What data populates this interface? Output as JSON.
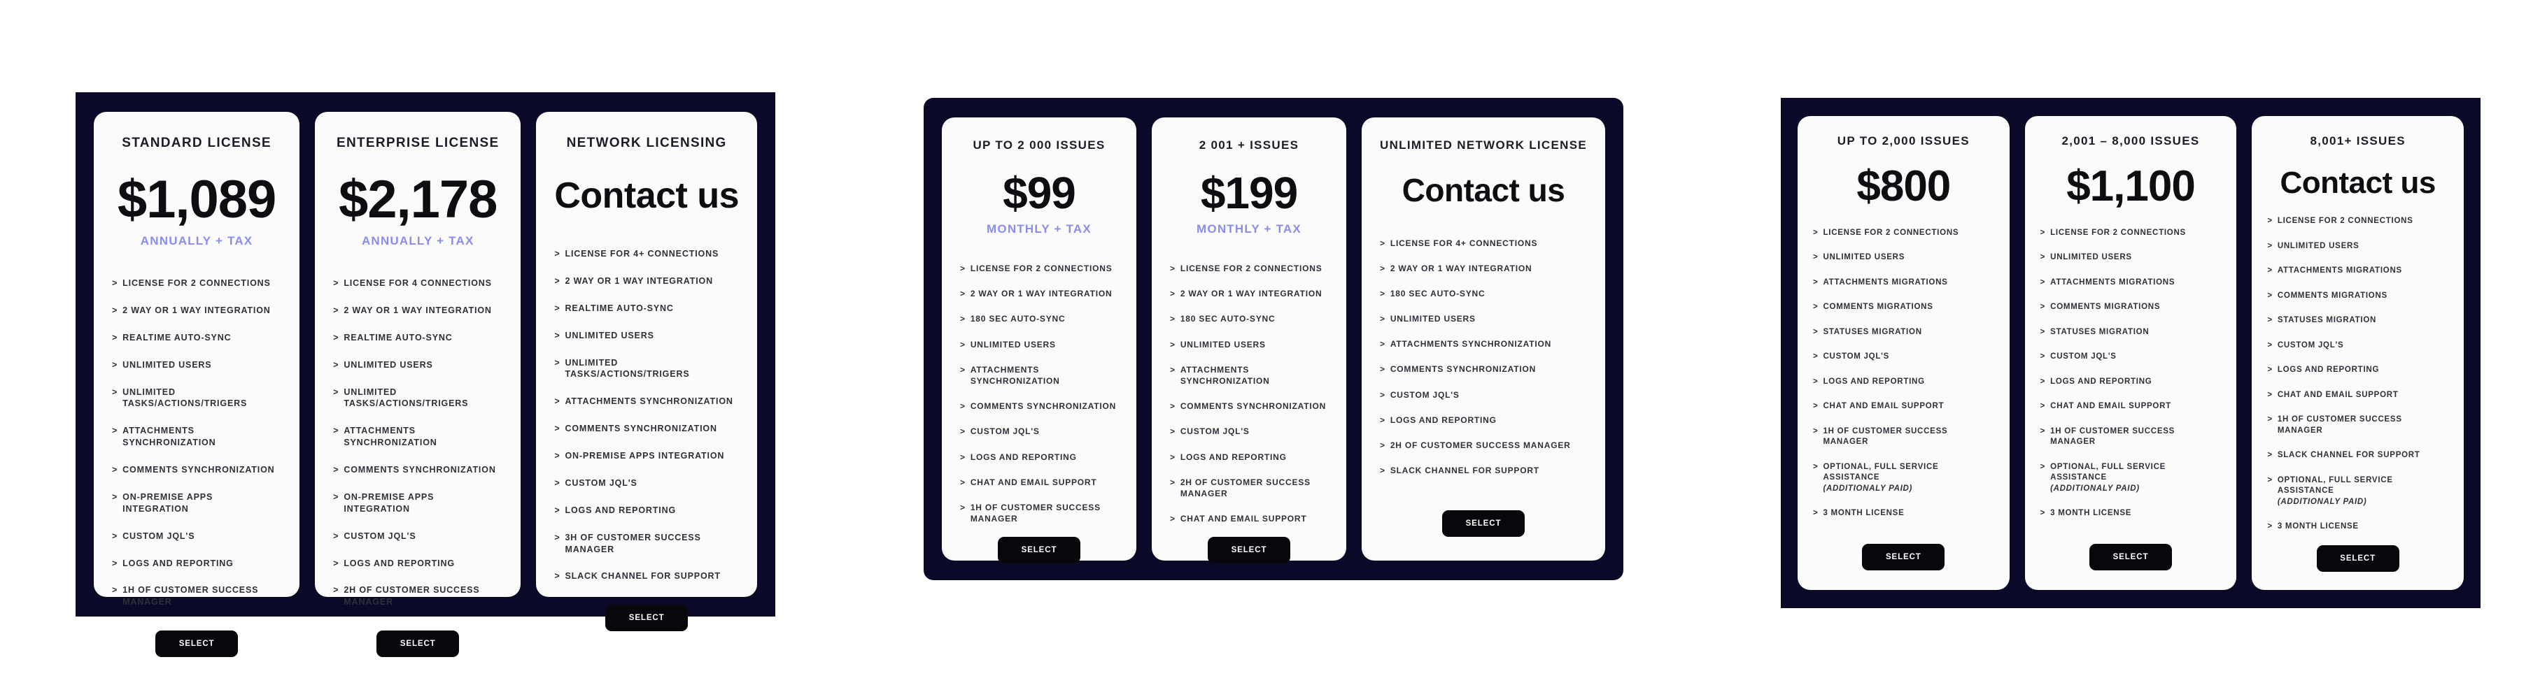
{
  "colors": {
    "panel_background": "#0a0a28",
    "card_background": "#fbfbfb",
    "price_text": "#0d0d12",
    "period_accent": "#8b8cf0",
    "feature_text": "#2f2f3a",
    "button_background": "#07070c",
    "button_text": "#ffffff",
    "page_background": "#ffffff"
  },
  "common": {
    "select_label": "SELECT",
    "bullet_glyph": ">"
  },
  "panels": [
    {
      "id": "panel-connection-licenses",
      "cards": [
        {
          "title": "STANDARD LICENSE",
          "price": "$1,089",
          "is_contact": false,
          "period": "ANNUALLY + TAX",
          "features": [
            "LICENSE FOR 2 CONNECTIONS",
            "2 WAY OR 1 WAY INTEGRATION",
            "REALTIME AUTO-SYNC",
            "UNLIMITED USERS",
            "UNLIMITED TASKS/ACTIONS/TRIGERS",
            "ATTACHMENTS SYNCHRONIZATION",
            "COMMENTS SYNCHRONIZATION",
            "ON-PREMISE APPS INTEGRATION",
            "CUSTOM JQL'S",
            "LOGS AND REPORTING",
            "1H OF CUSTOMER SUCCESS MANAGER"
          ],
          "button": "SELECT"
        },
        {
          "title": "ENTERPRISE LICENSE",
          "price": "$2,178",
          "is_contact": false,
          "period": "ANNUALLY + TAX",
          "features": [
            "LICENSE FOR 4 CONNECTIONS",
            "2 WAY OR 1 WAY INTEGRATION",
            "REALTIME AUTO-SYNC",
            "UNLIMITED USERS",
            "UNLIMITED TASKS/ACTIONS/TRIGERS",
            "ATTACHMENTS SYNCHRONIZATION",
            "COMMENTS SYNCHRONIZATION",
            "ON-PREMISE APPS INTEGRATION",
            "CUSTOM JQL'S",
            "LOGS AND REPORTING",
            "2H OF CUSTOMER SUCCESS MANAGER"
          ],
          "button": "SELECT"
        },
        {
          "title": "NETWORK LICENSING",
          "price": "Contact us",
          "is_contact": true,
          "period": "",
          "features": [
            "LICENSE FOR 4+ CONNECTIONS",
            "2 WAY OR 1 WAY INTEGRATION",
            "REALTIME AUTO-SYNC",
            "UNLIMITED USERS",
            "UNLIMITED TASKS/ACTIONS/TRIGERS",
            "ATTACHMENTS SYNCHRONIZATION",
            "COMMENTS SYNCHRONIZATION",
            "ON-PREMISE APPS INTEGRATION",
            "CUSTOM JQL'S",
            "LOGS AND REPORTING",
            "3H OF CUSTOMER SUCCESS MANAGER",
            "SLACK CHANNEL FOR SUPPORT"
          ],
          "button": "SELECT"
        }
      ]
    },
    {
      "id": "panel-issue-tier-monthly",
      "cards": [
        {
          "title": "UP TO 2 000 ISSUES",
          "price": "$99",
          "is_contact": false,
          "period": "MONTHLY + TAX",
          "features": [
            "LICENSE FOR 2 CONNECTIONS",
            "2 WAY OR 1 WAY INTEGRATION",
            "180 SEC AUTO-SYNC",
            "UNLIMITED USERS",
            "ATTACHMENTS SYNCHRONIZATION",
            "COMMENTS SYNCHRONIZATION",
            "CUSTOM JQL'S",
            "LOGS AND REPORTING",
            "CHAT AND EMAIL SUPPORT",
            "1H OF CUSTOMER SUCCESS MANAGER"
          ],
          "button": "SELECT"
        },
        {
          "title": "2 001 + ISSUES",
          "price": "$199",
          "is_contact": false,
          "period": "MONTHLY + TAX",
          "features": [
            "LICENSE FOR 2 CONNECTIONS",
            "2 WAY OR 1 WAY INTEGRATION",
            "180 SEC AUTO-SYNC",
            "UNLIMITED USERS",
            "ATTACHMENTS SYNCHRONIZATION",
            "COMMENTS SYNCHRONIZATION",
            "CUSTOM JQL'S",
            "LOGS AND REPORTING",
            "2H OF CUSTOMER SUCCESS MANAGER",
            "CHAT AND EMAIL SUPPORT"
          ],
          "button": "SELECT"
        },
        {
          "title": "UNLIMITED NETWORK LICENSE",
          "price": "Contact us",
          "is_contact": true,
          "period": "",
          "features": [
            "LICENSE FOR 4+ CONNECTIONS",
            "2 WAY OR 1 WAY INTEGRATION",
            "180 SEC AUTO-SYNC",
            "UNLIMITED USERS",
            "ATTACHMENTS SYNCHRONIZATION",
            "COMMENTS SYNCHRONIZATION",
            "CUSTOM JQL'S",
            "LOGS AND REPORTING",
            "2H OF CUSTOMER SUCCESS MANAGER",
            "SLACK CHANNEL FOR SUPPORT"
          ],
          "button": "SELECT"
        }
      ]
    },
    {
      "id": "panel-migration-tiers",
      "cards": [
        {
          "title": "UP TO 2,000 ISSUES",
          "price": "$800",
          "is_contact": false,
          "period": "",
          "features": [
            "LICENSE FOR 2 CONNECTIONS",
            "UNLIMITED USERS",
            "ATTACHMENTS MIGRATIONS",
            "COMMENTS MIGRATIONS",
            "STATUSES MIGRATION",
            "CUSTOM JQL'S",
            "LOGS AND REPORTING",
            "CHAT AND EMAIL SUPPORT",
            "1H OF CUSTOMER SUCCESS MANAGER",
            "OPTIONAL, FULL SERVICE ASSISTANCE",
            "3 MONTH LICENSE"
          ],
          "feature_notes": {
            "9": "(ADDITIONALY PAID)"
          },
          "button": "SELECT"
        },
        {
          "title": "2,001 – 8,000 ISSUES",
          "price": "$1,100",
          "is_contact": false,
          "period": "",
          "features": [
            "LICENSE FOR 2 CONNECTIONS",
            "UNLIMITED USERS",
            "ATTACHMENTS MIGRATIONS",
            "COMMENTS MIGRATIONS",
            "STATUSES MIGRATION",
            "CUSTOM JQL'S",
            "LOGS AND REPORTING",
            "CHAT AND EMAIL SUPPORT",
            "1H OF CUSTOMER SUCCESS MANAGER",
            "OPTIONAL, FULL SERVICE ASSISTANCE",
            "3 MONTH LICENSE"
          ],
          "feature_notes": {
            "9": "(ADDITIONALY PAID)"
          },
          "button": "SELECT"
        },
        {
          "title": "8,001+ ISSUES",
          "price": "Contact us",
          "is_contact": true,
          "period": "",
          "features": [
            "LICENSE FOR 2 CONNECTIONS",
            "UNLIMITED USERS",
            "ATTACHMENTS MIGRATIONS",
            "COMMENTS MIGRATIONS",
            "STATUSES MIGRATION",
            "CUSTOM JQL'S",
            "LOGS AND REPORTING",
            "CHAT AND EMAIL SUPPORT",
            "1H OF CUSTOMER SUCCESS MANAGER",
            "SLACK CHANNEL FOR SUPPORT",
            "OPTIONAL, FULL SERVICE ASSISTANCE",
            "3 MONTH LICENSE"
          ],
          "feature_notes": {
            "10": "(ADDITIONALY PAID)"
          },
          "button": "SELECT"
        }
      ]
    }
  ]
}
